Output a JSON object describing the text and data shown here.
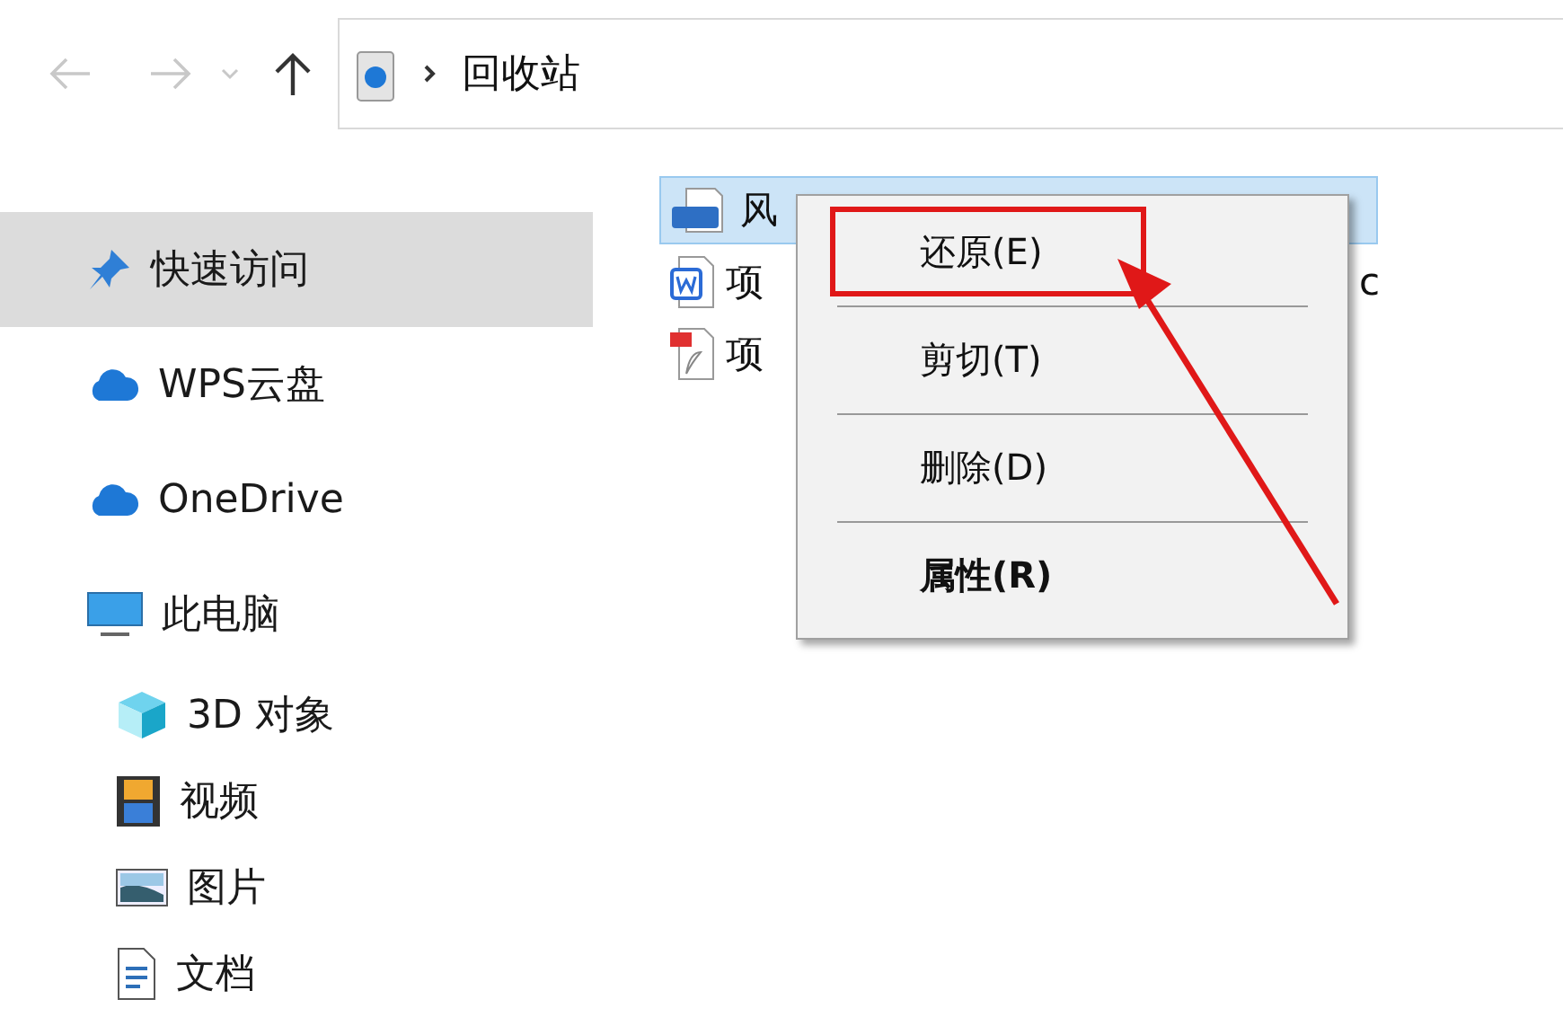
{
  "nav": {
    "back_disabled": true,
    "forward_disabled": true
  },
  "address": {
    "path": "回收站"
  },
  "sidebar": {
    "items": [
      {
        "label": "快速访问",
        "kind": "pin",
        "selected": true
      },
      {
        "label": "WPS云盘",
        "kind": "cloud",
        "selected": false
      },
      {
        "label": "OneDrive",
        "kind": "cloud",
        "selected": false
      },
      {
        "label": "此电脑",
        "kind": "pc",
        "selected": false,
        "children": [
          {
            "label": "3D 对象",
            "kind": "cube",
            "selected": false
          },
          {
            "label": "视频",
            "kind": "film",
            "selected": false
          },
          {
            "label": "图片",
            "kind": "picture",
            "selected": false
          },
          {
            "label": "文档",
            "kind": "doc",
            "selected": false
          }
        ]
      }
    ]
  },
  "files": [
    {
      "name": "风",
      "kind": "jpg",
      "selected": true
    },
    {
      "name": "项",
      "kind": "word",
      "selected": false,
      "tail": "c"
    },
    {
      "name": "项",
      "kind": "pdf",
      "selected": false
    }
  ],
  "context_menu": {
    "items": [
      {
        "label": "还原(E)",
        "bold": false,
        "highlighted": true
      },
      {
        "label": "剪切(T)",
        "bold": false,
        "highlighted": false
      },
      {
        "label": "删除(D)",
        "bold": false,
        "highlighted": false
      },
      {
        "label": "属性(R)",
        "bold": true,
        "highlighted": false
      }
    ]
  }
}
